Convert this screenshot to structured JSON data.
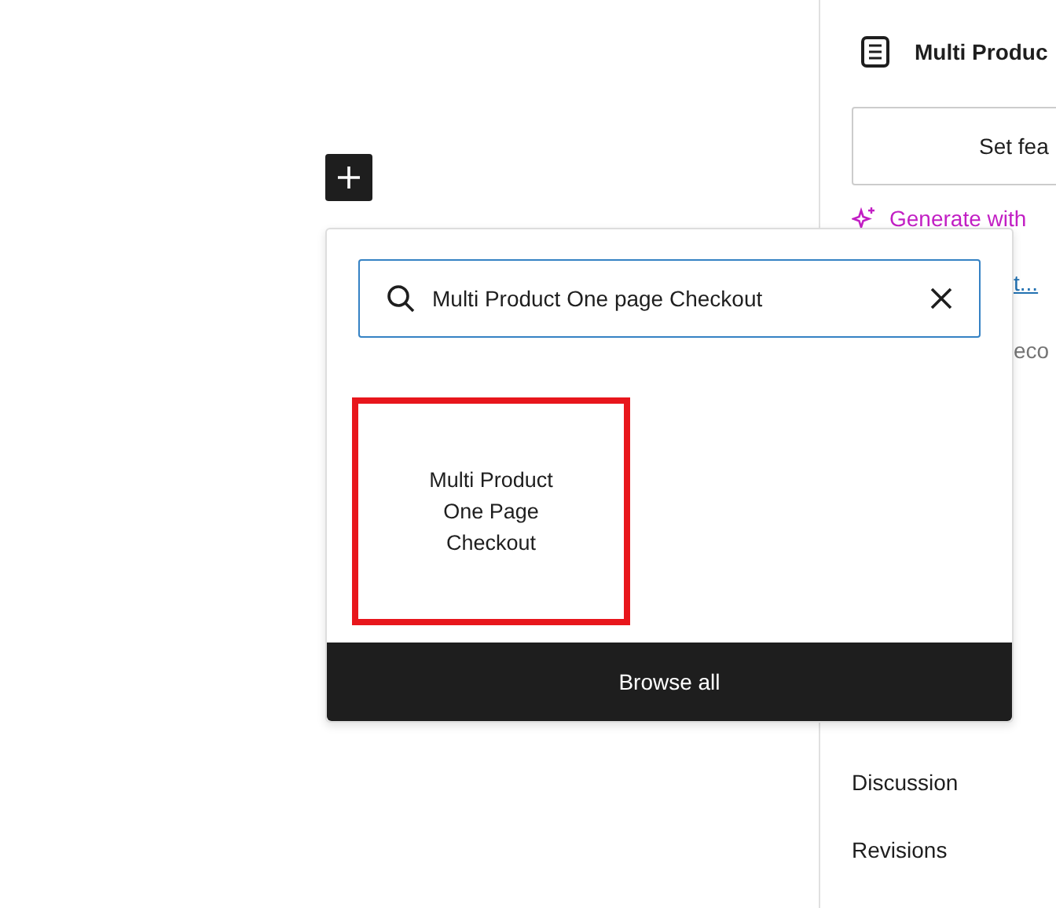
{
  "inserter": {
    "search": {
      "value": "Multi Product One page Checkout"
    },
    "results": [
      {
        "label": "Multi Product One Page Checkout",
        "selected": true
      }
    ],
    "browse_all": "Browse all"
  },
  "sidebar": {
    "title": "Multi Produc",
    "featured_button": "Set fea",
    "generate": "Generate with",
    "link": "t...",
    "text": "eco",
    "panels": [
      "Discussion",
      "Revisions"
    ]
  }
}
